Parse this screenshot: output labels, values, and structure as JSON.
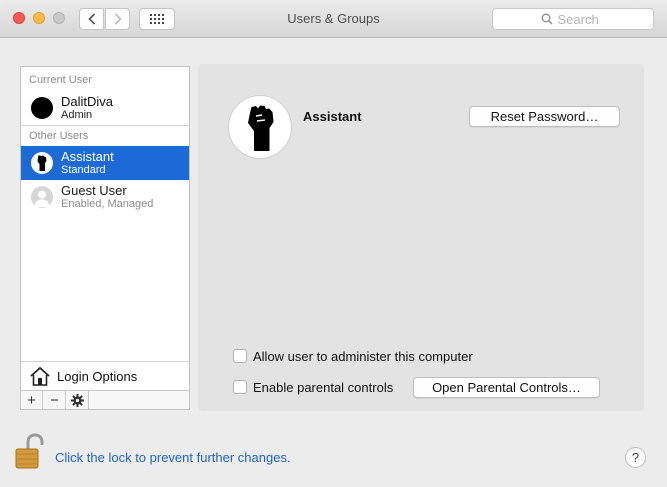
{
  "window": {
    "title": "Users & Groups",
    "search_placeholder": "Search"
  },
  "sidebar": {
    "current_user_label": "Current User",
    "other_users_label": "Other Users",
    "current_user": {
      "name": "DalitDiva",
      "role": "Admin",
      "avatar": "black-circle-avatar"
    },
    "other_users": [
      {
        "name": "Assistant",
        "role": "Standard",
        "avatar": "raised-fist-avatar",
        "selected": true
      },
      {
        "name": "Guest User",
        "role": "Enabled, Managed",
        "avatar": "generic-person-avatar",
        "selected": false
      }
    ],
    "login_options_label": "Login Options",
    "toolbar": {
      "add": "+",
      "remove": "−",
      "action": "gear-icon"
    }
  },
  "detail": {
    "user_name": "Assistant",
    "avatar": "raised-fist-avatar",
    "reset_password_label": "Reset Password…",
    "allow_admin_label": "Allow user to administer this computer",
    "allow_admin_checked": false,
    "parental_controls_label": "Enable parental controls",
    "parental_controls_checked": false,
    "open_parental_controls_label": "Open Parental Controls…"
  },
  "footer": {
    "lock_text": "Click the lock to prevent further changes.",
    "lock_state": "unlocked",
    "help_label": "?"
  },
  "colors": {
    "selection": "#1b6ad5",
    "link": "#1e63c4",
    "close": "#fc5753",
    "minimize": "#fdbc40"
  }
}
